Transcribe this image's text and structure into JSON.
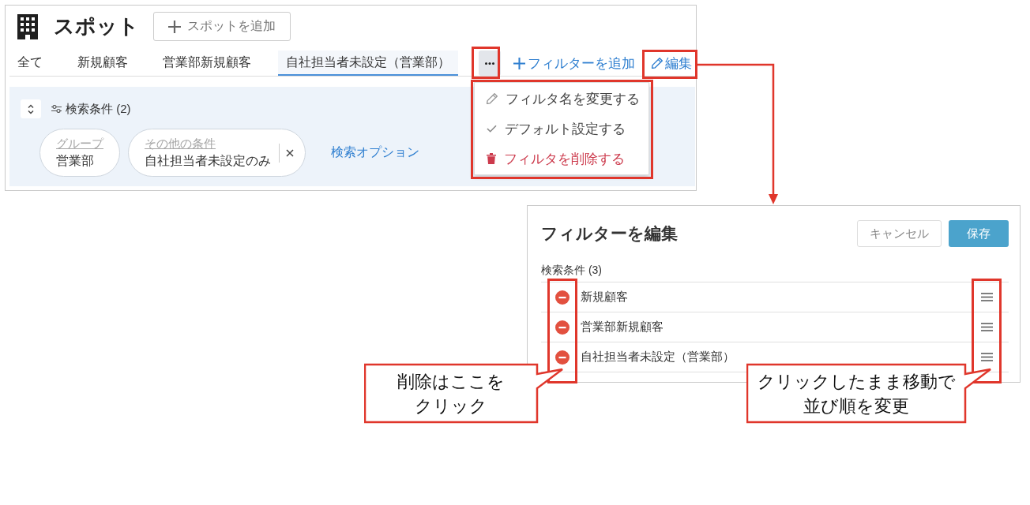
{
  "spot_panel": {
    "title": "スポット",
    "add_button": "スポットを追加",
    "tabs": [
      {
        "label": "全て",
        "selected": false
      },
      {
        "label": "新規顧客",
        "selected": false
      },
      {
        "label": "営業部新規顧客",
        "selected": false
      },
      {
        "label": "自社担当者未設定（営業部）",
        "selected": true
      }
    ],
    "more_button": {
      "highlighted": true
    },
    "add_filter_link": "フィルターを追加",
    "edit_link": {
      "label": "編集",
      "highlighted": true
    },
    "conditions": {
      "heading": "検索条件 (2)",
      "chips": [
        {
          "label": "グループ",
          "value": "営業部",
          "removable": false
        },
        {
          "label": "その他の条件",
          "value": "自社担当者未設定のみ",
          "removable": true
        }
      ],
      "options_link": "検索オプション"
    },
    "menu": {
      "open": true,
      "highlighted": true,
      "items": [
        {
          "kind": "rename",
          "label": "フィルタ名を変更する"
        },
        {
          "kind": "default",
          "label": "デフォルト設定する"
        },
        {
          "kind": "delete",
          "label": "フィルタを削除する"
        }
      ]
    }
  },
  "edit_panel": {
    "title": "フィルターを編集",
    "cancel_button": "キャンセル",
    "save_button": "保存",
    "heading": "検索条件 (3)",
    "rows": [
      {
        "label": "新規顧客"
      },
      {
        "label": "営業部新規顧客"
      },
      {
        "label": "自社担当者未設定（営業部）"
      }
    ],
    "remove_buttons": {
      "highlighted": true
    },
    "drag_handles": {
      "highlighted": true
    }
  },
  "annotations": {
    "callouts": [
      {
        "text": "削除はここをクリック"
      },
      {
        "text": "クリックしたまま移動で並び順を変更"
      }
    ]
  }
}
